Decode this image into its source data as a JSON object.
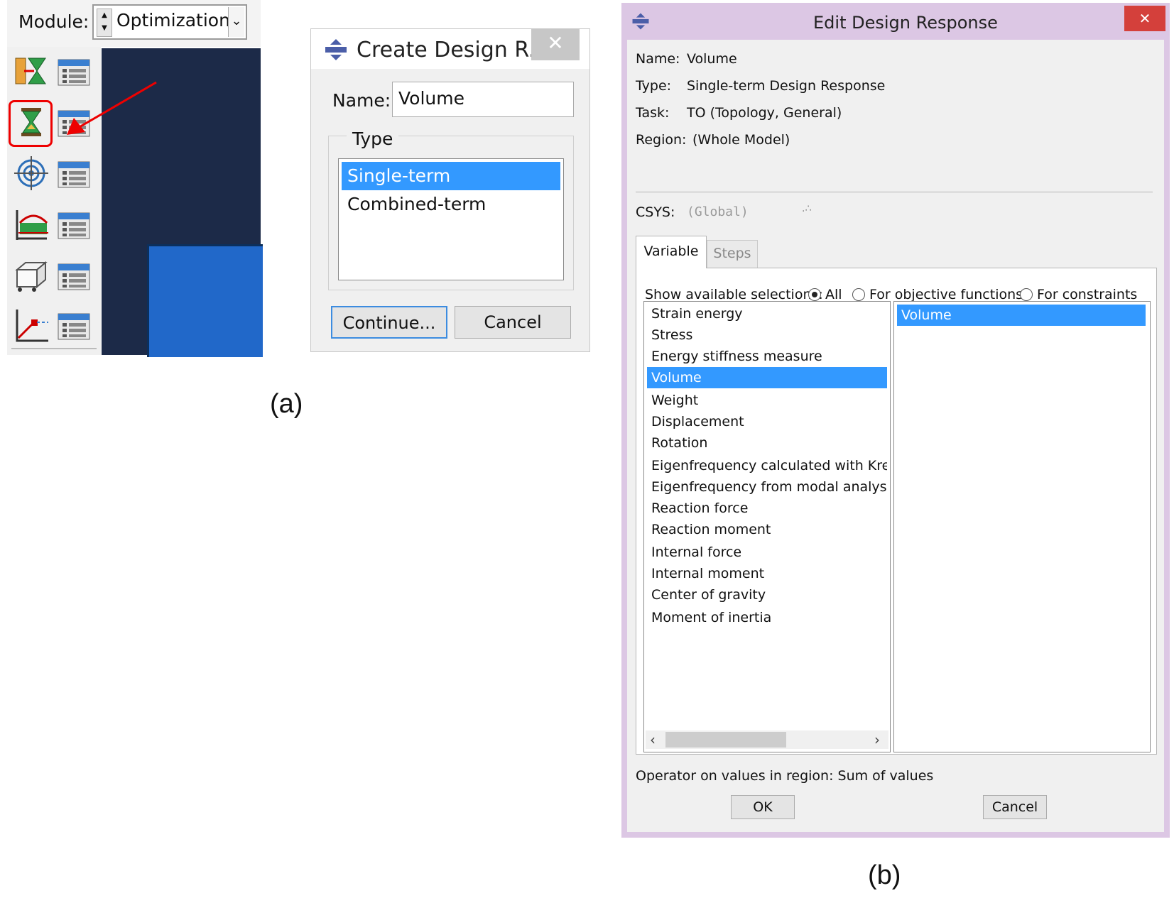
{
  "panel_a": {
    "label": "(a)",
    "module": {
      "label": "Module:",
      "value": "Optimization"
    },
    "toolbox_icons": [
      "task-create-icon",
      "task-manager-icon",
      "design-response-create-icon",
      "design-response-manager-icon",
      "objective-function-create-icon",
      "objective-function-manager-icon",
      "constraint-create-icon",
      "constraint-manager-icon",
      "geometric-restriction-create-icon",
      "geometric-restriction-manager-icon",
      "stop-condition-create-icon",
      "stop-condition-manager-icon"
    ],
    "create_dialog": {
      "title": "Create Design R...",
      "close": "✕",
      "name_label": "Name:",
      "name_value": "Volume",
      "type_legend": "Type",
      "type_options": [
        "Single-term",
        "Combined-term"
      ],
      "selected_type": "Single-term",
      "continue_label": "Continue...",
      "cancel_label": "Cancel"
    }
  },
  "panel_b": {
    "label": "(b)",
    "title": "Edit Design Response",
    "close": "✕",
    "info": {
      "name_label": "Name:",
      "name_value": "Volume",
      "type_label": "Type:",
      "type_value": "Single-term Design Response",
      "task_label": "Task:",
      "task_value": "TO (Topology, General)",
      "region_label": "Region:",
      "region_value": "(Whole Model)",
      "csys_label": "CSYS:",
      "csys_value": "(Global)"
    },
    "tabs": [
      "Variable",
      "Steps"
    ],
    "active_tab": "Variable",
    "show_label": "Show available selections:",
    "radio_options": [
      "All",
      "For objective functions",
      "For constraints"
    ],
    "radio_selected": "All",
    "variables": [
      "Strain energy",
      "Stress",
      "Energy stiffness measure",
      "Volume",
      "Weight",
      "Displacement",
      "Rotation",
      "Eigenfrequency calculated with Kreisse",
      "Eigenfrequency from modal analysis",
      "Reaction force",
      "Reaction moment",
      "Internal force",
      "Internal moment",
      "Center of gravity",
      "Moment of inertia"
    ],
    "selected_variable": "Volume",
    "selected_list": [
      "Volume"
    ],
    "operator_text": "Operator on values in region: Sum of values",
    "ok_label": "OK",
    "cancel_label": "Cancel"
  },
  "colors": {
    "selection": "#3399ff",
    "highlight_box": "#e00000",
    "arrow": "#e00000",
    "viewport": "#1c2a48",
    "part": "#2168c9",
    "edit_frame": "#dcc7e4",
    "edit_close": "#d4403b"
  }
}
